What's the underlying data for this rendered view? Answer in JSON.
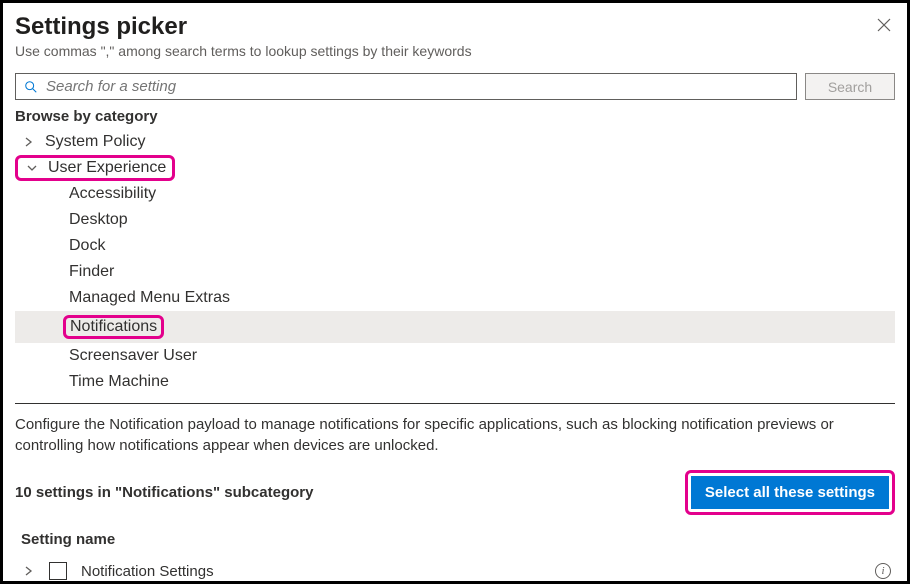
{
  "header": {
    "title": "Settings picker",
    "subtitle": "Use commas \",\" among search terms to lookup settings by their keywords"
  },
  "search": {
    "placeholder": "Search for a setting",
    "button": "Search"
  },
  "browse_label": "Browse by category",
  "tree": {
    "system_policy": "System Policy",
    "user_experience": "User Experience",
    "children": {
      "accessibility": "Accessibility",
      "desktop": "Desktop",
      "dock": "Dock",
      "finder": "Finder",
      "managed_menu_extras": "Managed Menu Extras",
      "notifications": "Notifications",
      "screensaver_user": "Screensaver User",
      "time_machine": "Time Machine"
    }
  },
  "description": "Configure the Notification payload to manage notifications for specific applications, such as blocking notification previews or controlling how notifications appear when devices are unlocked.",
  "subcategory_count": "10 settings in \"Notifications\" subcategory",
  "select_all": "Select all these settings",
  "column_header": "Setting name",
  "settings": {
    "row0": "Notification Settings"
  }
}
